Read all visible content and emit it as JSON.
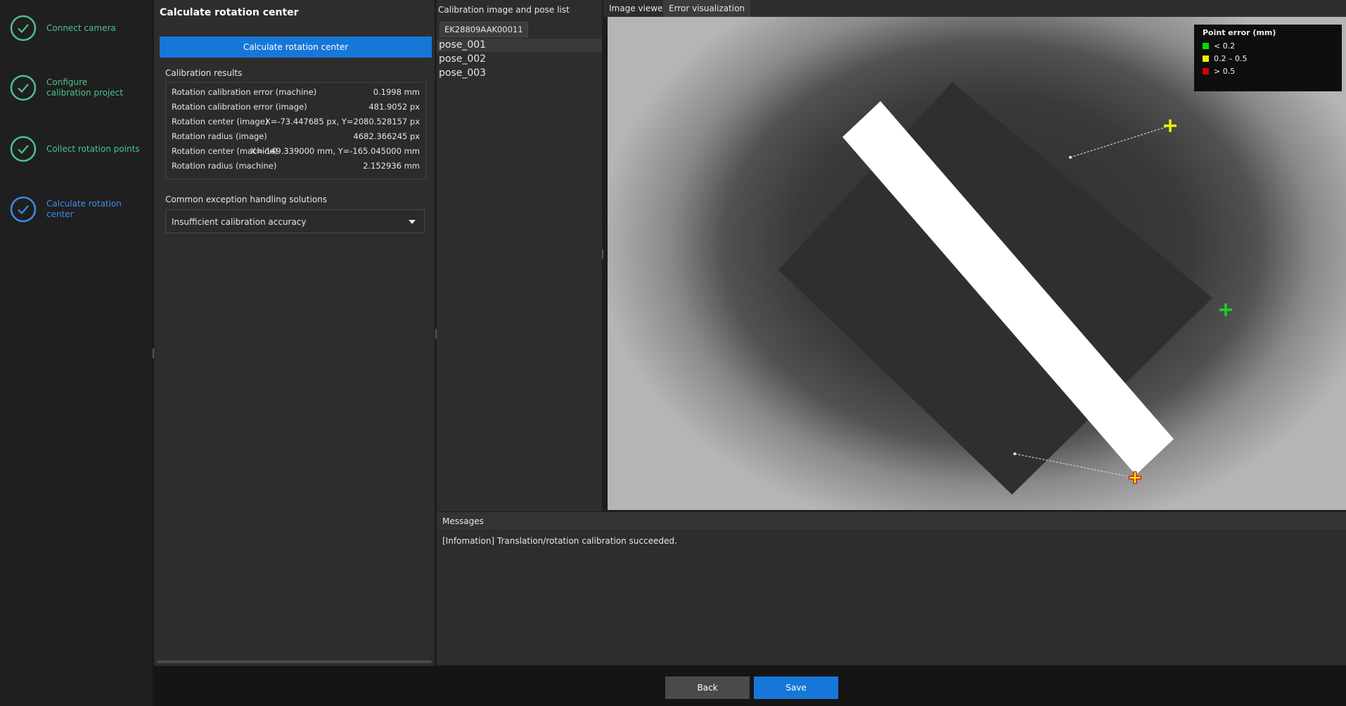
{
  "steps": [
    {
      "label": "Connect camera",
      "status": "done"
    },
    {
      "label": "Configure calibration project",
      "status": "done"
    },
    {
      "label": "Collect rotation points",
      "status": "done"
    },
    {
      "label": "Calculate rotation center",
      "status": "active"
    }
  ],
  "config": {
    "title": "Calculate rotation center",
    "calc_button": "Calculate rotation center",
    "results_label": "Calibration results",
    "results": [
      {
        "key": "Rotation calibration error (machine)",
        "value": "0.1998 mm"
      },
      {
        "key": "Rotation calibration error (image)",
        "value": "481.9052 px"
      },
      {
        "key": "Rotation center (image)",
        "value": "X=-73.447685 px, Y=2080.528157 px"
      },
      {
        "key": "Rotation radius (image)",
        "value": "4682.366245 px"
      },
      {
        "key": "Rotation center (machine)",
        "value": "X=-149.339000 mm, Y=-165.045000 mm"
      },
      {
        "key": "Rotation radius (machine)",
        "value": "2.152936 mm"
      }
    ],
    "exceptions_label": "Common exception handling solutions",
    "exception_selected": "Insufficient calibration accuracy"
  },
  "pose_list": {
    "title": "Calibration image and pose list",
    "camera": "EK28809AAK00011",
    "poses": [
      "pose_001",
      "pose_002",
      "pose_003"
    ],
    "selected": "pose_001"
  },
  "viewer": {
    "tabs": [
      "Image viewer",
      "Error visualization"
    ],
    "active_tab": "Error visualization",
    "legend": {
      "title": "Point error (mm)",
      "items": [
        {
          "label": "< 0.2",
          "color": "#00e000"
        },
        {
          "label": "0.2 – 0.5",
          "color": "#f0f000"
        },
        {
          "label": "> 0.5",
          "color": "#e00000"
        }
      ]
    }
  },
  "messages": {
    "title": "Messages",
    "text": "[Infomation] Translation/rotation calibration succeeded."
  },
  "footer": {
    "back": "Back",
    "save": "Save"
  },
  "colors": {
    "accent": "#1677d9",
    "done": "#4cc38a",
    "active": "#3a8fe8"
  }
}
